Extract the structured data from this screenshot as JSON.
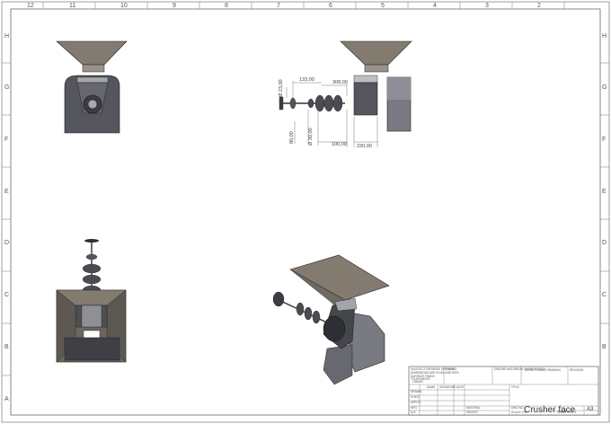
{
  "sheet": {
    "column_labels": [
      "12",
      "11",
      "10",
      "9",
      "8",
      "7",
      "6",
      "5",
      "4",
      "3",
      "2"
    ],
    "row_labels": [
      "H",
      "G",
      "F",
      "E",
      "D",
      "C",
      "B",
      "A"
    ]
  },
  "dimensions": {
    "d1": "133,00",
    "d2": "308,00",
    "d3": "Ø 23,00",
    "d4": "80,00",
    "d5": "Ø 30,00",
    "d6": "100,00",
    "d7": "230,00"
  },
  "title_block": {
    "drawing_title": "Crusher face",
    "sheet_size": "A3",
    "notes": [
      "UNLESS OTHERWISE SPECIFIED:",
      "DIMENSIONS ARE IN MILLIMETERS",
      "SURFACE FINISH:",
      "TOLERANCES:",
      "LINEAR:",
      "ANGULAR:"
    ],
    "finish_label": "FINISH:",
    "deburr_label": "DEBURR AND BREAK SHARP EDGES",
    "do_not_scale": "DO NOT SCALE DRAWING",
    "revision_label": "REVISION",
    "name_cols": [
      "NAME",
      "SIGNATURE",
      "DATE"
    ],
    "row_names": [
      "DRAWN",
      "CHK'D",
      "APPV'D",
      "MFG",
      "Q.A"
    ],
    "title_label": "TITLE:",
    "material_label": "MATERIAL:",
    "weight_label": "WEIGHT:",
    "dwg_no_label": "DWG NO.",
    "scale_label": "SCALE:1:10",
    "sheet_label": "SHEET 1 OF 1"
  },
  "colors": {
    "hopper": "#837b70",
    "body_dark": "#54555d",
    "body_mid": "#797a82",
    "line": "#222222"
  }
}
